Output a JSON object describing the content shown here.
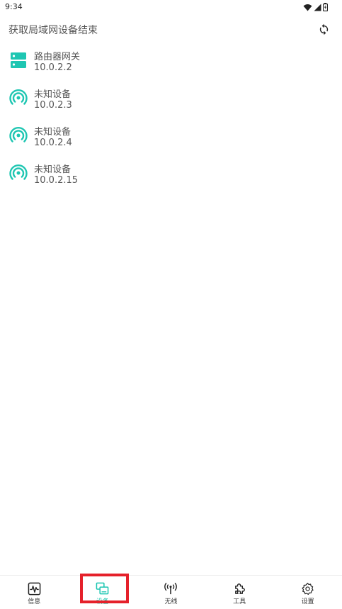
{
  "status_bar": {
    "time": "9:34",
    "icons": [
      "wifi-icon",
      "signal-icon",
      "battery-icon"
    ]
  },
  "header": {
    "title": "获取局域网设备结束",
    "refresh_icon": "refresh-icon"
  },
  "colors": {
    "accent": "#1ec6b2",
    "highlight": "#e5202a"
  },
  "devices": [
    {
      "name": "路由器网关",
      "ip": "10.0.2.2",
      "icon": "router-icon"
    },
    {
      "name": "未知设备",
      "ip": "10.0.2.3",
      "icon": "broadcast-icon"
    },
    {
      "name": "未知设备",
      "ip": "10.0.2.4",
      "icon": "broadcast-icon"
    },
    {
      "name": "未知设备",
      "ip": "10.0.2.15",
      "icon": "broadcast-icon"
    }
  ],
  "bottom_nav": {
    "items": [
      {
        "label": "信息",
        "icon": "activity-icon",
        "active": false
      },
      {
        "label": "设备",
        "icon": "devices-icon",
        "active": true
      },
      {
        "label": "无线",
        "icon": "antenna-icon",
        "active": false
      },
      {
        "label": "工具",
        "icon": "puzzle-icon",
        "active": false
      },
      {
        "label": "设置",
        "icon": "gear-icon",
        "active": false
      }
    ]
  }
}
